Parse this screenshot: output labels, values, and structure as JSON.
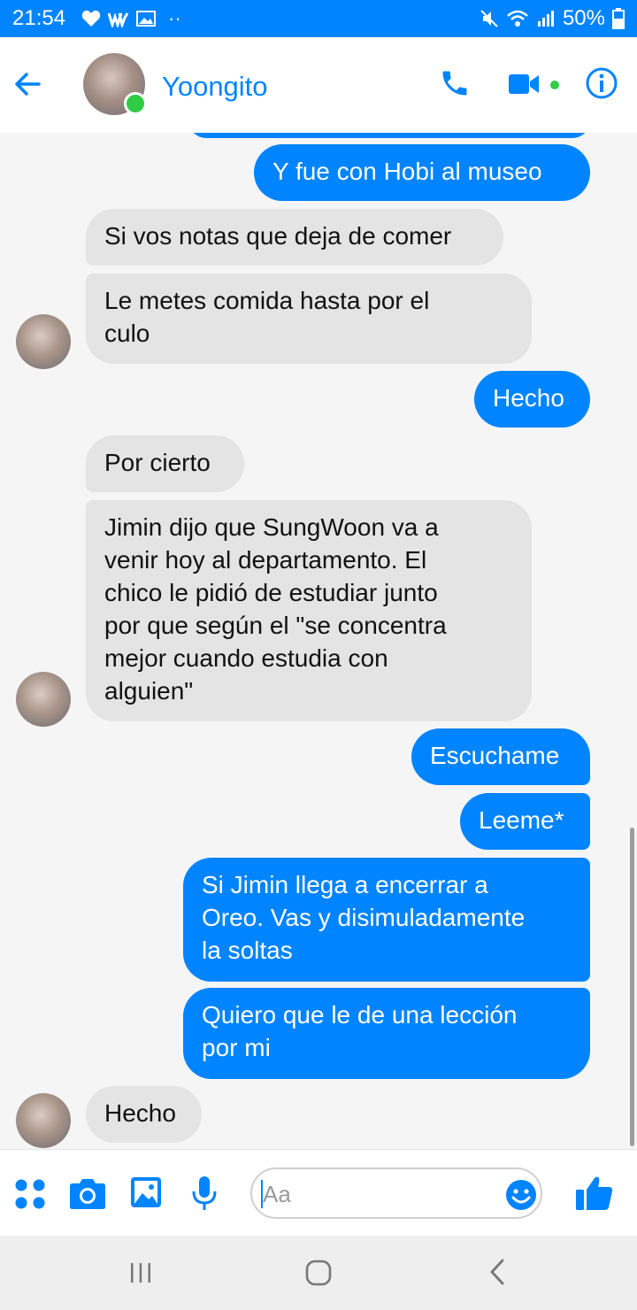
{
  "status_bar": {
    "time": "21:54",
    "battery": "50%"
  },
  "header": {
    "contact_name": "Yoongito"
  },
  "messages": [
    {
      "from": "me",
      "text": "Y fue con Hobi al museo"
    },
    {
      "from": "them",
      "text": "Si vos notas que deja de comer"
    },
    {
      "from": "them",
      "text": "Le metes comida hasta por el\nculo"
    },
    {
      "from": "me",
      "text": "Hecho"
    },
    {
      "from": "them",
      "text": "Por cierto"
    },
    {
      "from": "them",
      "text": "Jimin dijo que SungWoon va a\nvenir hoy al departamento. El\nchico le pidió de estudiar junto\npor que según el \"se concentra\nmejor cuando estudia con\nalguien\""
    },
    {
      "from": "me",
      "text": "Escuchame"
    },
    {
      "from": "me",
      "text": "Leeme*"
    },
    {
      "from": "me",
      "text": "Si Jimin llega a encerrar a\nOreo. Vas y disimuladamente\nla soltas"
    },
    {
      "from": "me",
      "text": "Quiero que le de una lección\npor mi"
    },
    {
      "from": "them",
      "text": "Hecho"
    }
  ],
  "composer": {
    "placeholder": "Aa"
  },
  "colors": {
    "accent": "#0084ff",
    "incoming_bubble": "#e4e4e4",
    "online": "#31cc46"
  },
  "icons": [
    "back-arrow-icon",
    "phone-icon",
    "video-camera-icon",
    "info-icon",
    "apps-icon",
    "camera-icon",
    "image-icon",
    "microphone-icon",
    "emoji-icon",
    "thumbs-up-icon"
  ]
}
